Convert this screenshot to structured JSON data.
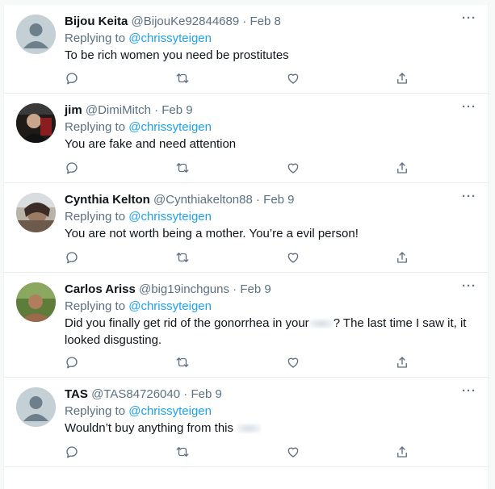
{
  "tweets": [
    {
      "name": "Bijou Keita",
      "handle": "@BijouKe92844689",
      "date": "Feb 8",
      "replying_prefix": "Replying to ",
      "replying_to": "@chrissyteigen",
      "text": "To be rich women you need be prostitutes",
      "avatar": "default-avatar"
    },
    {
      "name": "jim",
      "handle": "@DimiMitch",
      "date": "Feb 9",
      "replying_prefix": "Replying to ",
      "replying_to": "@chrissyteigen",
      "text": "You are fake and need attention",
      "avatar": "photo-avatar"
    },
    {
      "name": "Cynthia Kelton",
      "handle": "@Cynthiakelton88",
      "date": "Feb 9",
      "replying_prefix": "Replying to ",
      "replying_to": "@chrissyteigen",
      "text": "You are not worth being a mother. You’re a evil person!",
      "avatar": "photo-avatar"
    },
    {
      "name": "Carlos Ariss",
      "handle": "@big19inchguns",
      "date": "Feb 9",
      "replying_prefix": "Replying to ",
      "replying_to": "@chrissyteigen",
      "text_before": "Did you finally get rid of the gonorrhea in your",
      "text_after": "? The last time I saw it, it",
      "text_line2": "looked disgusting.",
      "avatar": "photo-avatar"
    },
    {
      "name": "TAS",
      "handle": "@TAS84726040",
      "date": "Feb 9",
      "replying_prefix": "Replying to ",
      "replying_to": "@chrissyteigen",
      "text": "Wouldn’t buy anything from this",
      "avatar": "default-avatar"
    }
  ],
  "separator": " · ",
  "more_label": "···",
  "icons": [
    "reply-icon",
    "retweet-icon",
    "like-icon",
    "share-icon",
    "more-icon"
  ],
  "colors": {
    "link": "#1da1f2",
    "secondary": "#5b7083",
    "text": "#0f1419",
    "border": "#e6ecf0"
  }
}
